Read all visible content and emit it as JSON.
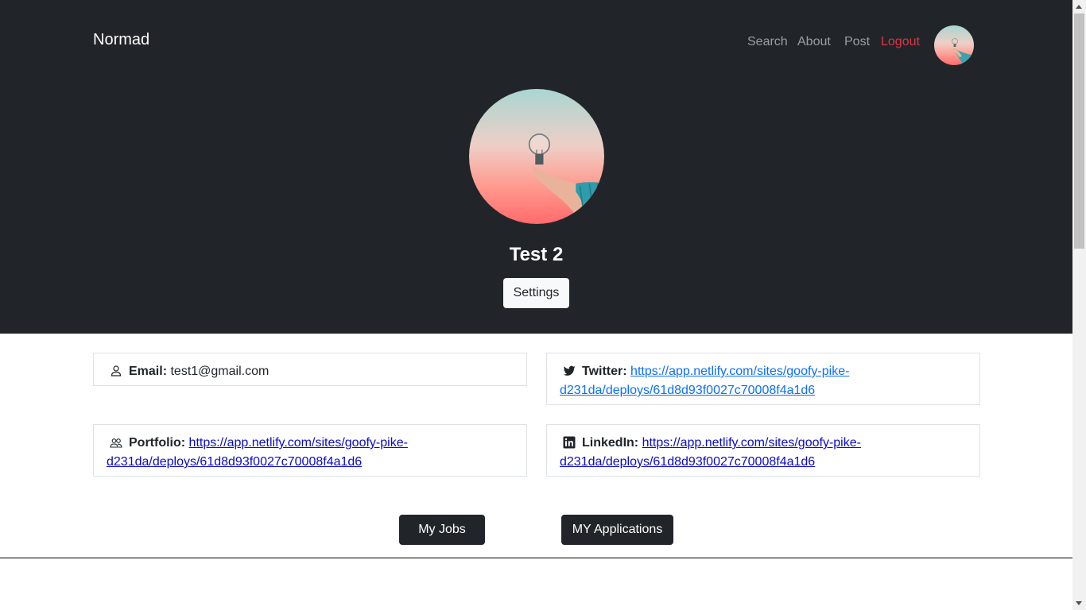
{
  "nav": {
    "brand": "Normad",
    "links": [
      "Search",
      "About",
      "Post",
      "Logout"
    ],
    "logout_color": "#dc3545"
  },
  "profile": {
    "name": "Test 2",
    "settings_label": "Settings"
  },
  "info": {
    "email": {
      "label": "Email:",
      "value": "test1@gmail.com",
      "icon": "person-icon"
    },
    "twitter": {
      "label": "Twitter:",
      "value": "https://app.netlify.com/sites/goofy-pike-d231da/deploys/61d8d93f0027c70008f4a1d6",
      "icon": "twitter-icon"
    },
    "portfolio": {
      "label": "Portfolio:",
      "value": "https://app.netlify.com/sites/goofy-pike-d231da/deploys/61d8d93f0027c70008f4a1d6",
      "icon": "people-icon"
    },
    "linkedin": {
      "label": "LinkedIn:",
      "value": "https://app.netlify.com/sites/goofy-pike-d231da/deploys/61d8d93f0027c70008f4a1d6",
      "icon": "linkedin-icon"
    }
  },
  "actions": {
    "my_jobs": "My Jobs",
    "my_applications": "MY Applications"
  },
  "colors": {
    "header_bg": "#212529",
    "link": "#0d6efd"
  }
}
